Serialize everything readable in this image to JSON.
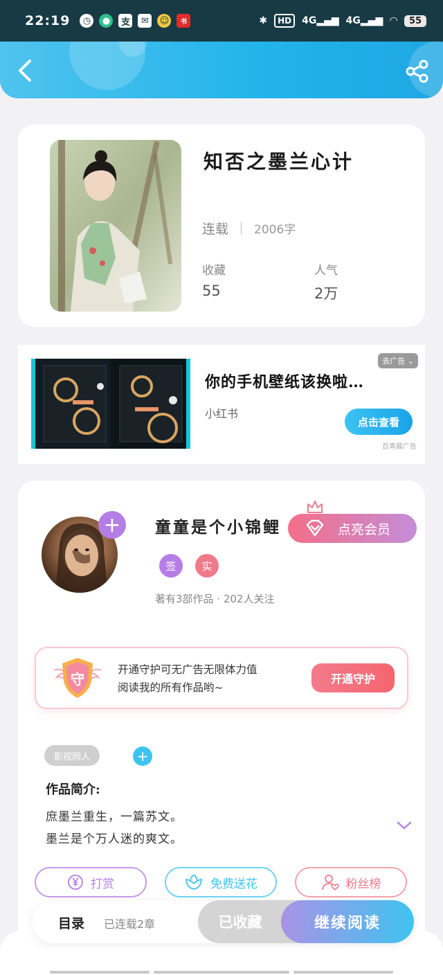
{
  "status_bar": {
    "time": "22:19",
    "network_1": "4G",
    "network_2": "4G",
    "hd_label": "HD",
    "battery": "55",
    "app_icons": [
      "clock-icon",
      "chat-icon",
      "alipay-icon",
      "mail-icon",
      "face-icon",
      "xiaohongshu-icon"
    ]
  },
  "header": {
    "back_icon": "back-arrow-icon",
    "share_icon": "share-icon"
  },
  "book": {
    "title": "知否之墨兰心计",
    "status": "连载",
    "word_count": "2006字",
    "favorites_label": "收藏",
    "favorites_value": "55",
    "popularity_label": "人气",
    "popularity_value": "2万"
  },
  "ad": {
    "title": "你的手机壁纸该换啦…",
    "source": "小红书",
    "close_label": "去广告",
    "cta_label": "点击查看",
    "footnote": "百青藤广告"
  },
  "author": {
    "name": "童童是个小锦鲤",
    "member_button": "点亮会员",
    "badges": [
      "签",
      "实"
    ],
    "meta": "著有3部作品 · 202人关注",
    "guard_text_line1": "开通守护可无广告无限体力值",
    "guard_text_line2": "阅读我的所有作品哟~",
    "guard_button": "开通守护",
    "guard_emblem": "守"
  },
  "work": {
    "tag": "影视同人",
    "intro_title": "作品简介:",
    "intro_line1": "庶墨兰重生，一篇苏文。",
    "intro_line2": "墨兰是个万人迷的爽文。"
  },
  "actions": {
    "tip": "打赏",
    "flower": "免费送花",
    "fans": "粉丝榜"
  },
  "bottom_bar": {
    "toc": "目录",
    "chapters": "已连载2章",
    "collected": "已收藏",
    "read": "继续阅读"
  },
  "colors": {
    "header_blue": "#21b4ea",
    "accent_purple": "#b57ee6",
    "accent_pink": "#f36f88",
    "tip_color": "#b57ee6",
    "flower_color": "#3cc4ef",
    "fans_color": "#f07a8a"
  }
}
